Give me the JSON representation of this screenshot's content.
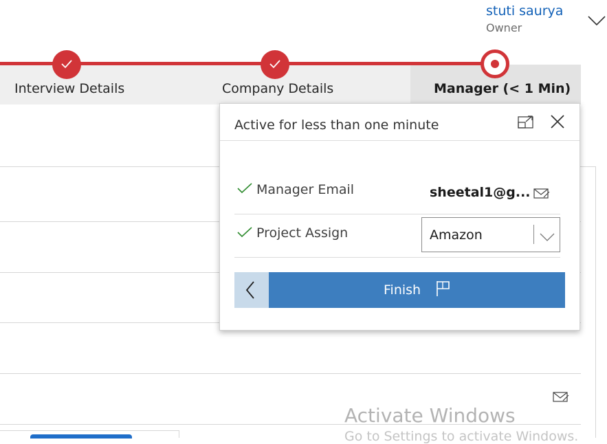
{
  "user": {
    "name": "stuti saurya",
    "role": "Owner"
  },
  "stages": [
    {
      "label": "Interview Details",
      "state": "completed"
    },
    {
      "label": "Company Details",
      "state": "completed"
    },
    {
      "label": "Manager  (< 1 Min)",
      "state": "active"
    }
  ],
  "flyout": {
    "title": "Active for less than one minute",
    "fields": [
      {
        "label": "Manager Email",
        "value": "sheetal1@g...",
        "icon": "mail-icon"
      },
      {
        "label": "Project Assign",
        "value": "Amazon",
        "icon": "chevron-down-icon"
      }
    ],
    "finish_label": "Finish"
  },
  "watermark": {
    "title": "Activate Windows",
    "subtitle": "Go to Settings to activate Windows."
  },
  "colors": {
    "accent_red": "#d13438",
    "finish_blue": "#3d7ebf",
    "back_blue": "#c8daea",
    "link_blue": "#1160b7",
    "check_green": "#2e8b2e"
  }
}
